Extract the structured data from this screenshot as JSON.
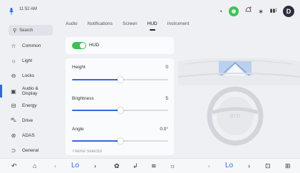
{
  "status": {
    "time": "11:52 AM",
    "avatar_letter": "D",
    "icons": [
      "microphone-icon",
      "speedometer-icon",
      "recording-icon",
      "bell-icon",
      "bluetooth-icon",
      "signal-icon",
      "avatar"
    ]
  },
  "sidebar": {
    "search_label": "Search",
    "items": [
      {
        "label": "Common",
        "icon": "star-icon",
        "glyph": "☆"
      },
      {
        "label": "Light",
        "icon": "sun-icon",
        "glyph": "☼"
      },
      {
        "label": "Locks",
        "icon": "lock-icon",
        "glyph": "⊖"
      },
      {
        "label": "Audio &",
        "label2": "Display",
        "icon": "display-icon",
        "glyph": "▣",
        "active": true
      },
      {
        "label": "Energy",
        "icon": "battery-icon",
        "glyph": "⊟"
      },
      {
        "label": "Drive",
        "icon": "car-icon",
        "glyph": "⛍"
      },
      {
        "label": "ADAS",
        "icon": "steering-icon",
        "glyph": "⊛"
      },
      {
        "label": "General",
        "icon": "general-icon",
        "glyph": "⊃"
      }
    ]
  },
  "tabs": [
    {
      "label": "Audio"
    },
    {
      "label": "Notifications"
    },
    {
      "label": "Screen"
    },
    {
      "label": "HUD",
      "active": true
    },
    {
      "label": "Instrument"
    }
  ],
  "hud": {
    "toggle_label": "HUD",
    "toggle_on": true
  },
  "sliders": [
    {
      "label": "Height",
      "value": "0",
      "fraction": 0.5
    },
    {
      "label": "Brightness",
      "value": "5",
      "fraction": 0.5
    },
    {
      "label": "Angle",
      "value": "0.0°",
      "fraction": 0.5
    }
  ],
  "cut_label": "Theme Selector",
  "bottom": {
    "left_temp": "Lo",
    "right_temp": "Lo",
    "items": [
      "back-icon",
      "home-icon",
      "chevron-left-icon",
      "chevron-right-icon",
      "fan-icon",
      "seat-heat-icon",
      "seat-vent-icon",
      "fan-speed-icon",
      "chevron-left-icon",
      "chevron-right-icon",
      "defrost-icon",
      "apps-icon"
    ]
  },
  "colors": {
    "accent": "#2f6bd8",
    "toggle_on": "#3fbf55",
    "recording": "#3fc25b"
  }
}
